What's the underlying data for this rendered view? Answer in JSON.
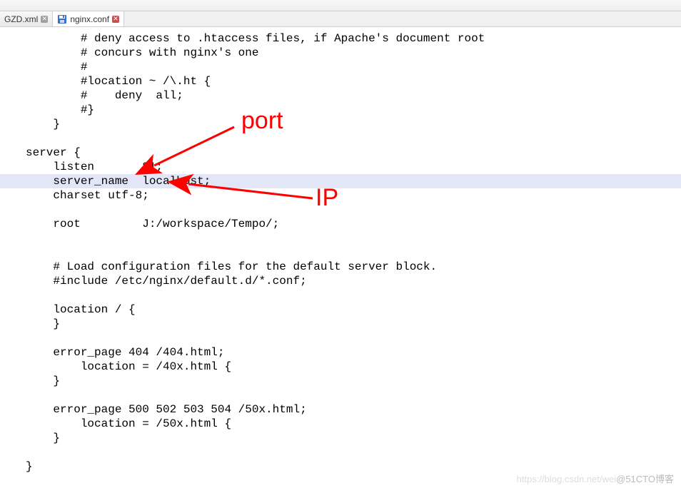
{
  "tabs": [
    {
      "label": "GZD.xml",
      "icon": "none"
    },
    {
      "label": "nginx.conf",
      "icon": "save"
    }
  ],
  "code": {
    "lines": [
      "        # deny access to .htaccess files, if Apache's document root",
      "        # concurs with nginx's one",
      "        #",
      "        #location ~ /\\.ht {",
      "        #    deny  all;",
      "        #}",
      "    }",
      "",
      "server {",
      "    listen       81;",
      "    server_name  localhost;",
      "    charset utf-8;",
      "",
      "    root         J:/workspace/Tempo/;",
      "",
      "",
      "    # Load configuration files for the default server block.",
      "    #include /etc/nginx/default.d/*.conf;",
      "",
      "    location / {",
      "    }",
      "",
      "    error_page 404 /404.html;",
      "        location = /40x.html {",
      "    }",
      "",
      "    error_page 500 502 503 504 /50x.html;",
      "        location = /50x.html {",
      "    }",
      "",
      "}"
    ],
    "highlight_index": 10
  },
  "annotations": {
    "port_label": "port",
    "ip_label": "IP"
  },
  "watermark": {
    "light": "https://blog.csdn.net/wei",
    "dark": "@51CTO博客"
  }
}
